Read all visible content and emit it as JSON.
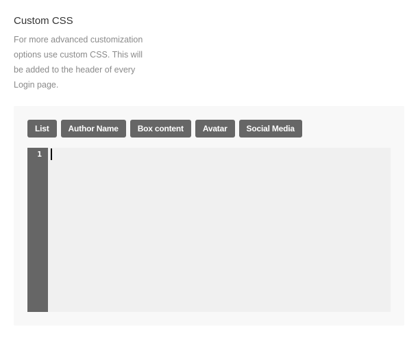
{
  "section": {
    "title": "Custom CSS",
    "description": "For more advanced customization options use custom CSS. This will be added to the header of every Login page."
  },
  "toolbar": {
    "buttons": [
      {
        "label": "List"
      },
      {
        "label": "Author Name"
      },
      {
        "label": "Box content"
      },
      {
        "label": "Avatar"
      },
      {
        "label": "Social Media"
      }
    ]
  },
  "editor": {
    "line_numbers": [
      "1"
    ],
    "content": ""
  },
  "colors": {
    "button_bg": "#666666",
    "gutter_bg": "#666666",
    "editor_bg": "#f0f0f0",
    "panel_bg": "#f8f8f8"
  }
}
